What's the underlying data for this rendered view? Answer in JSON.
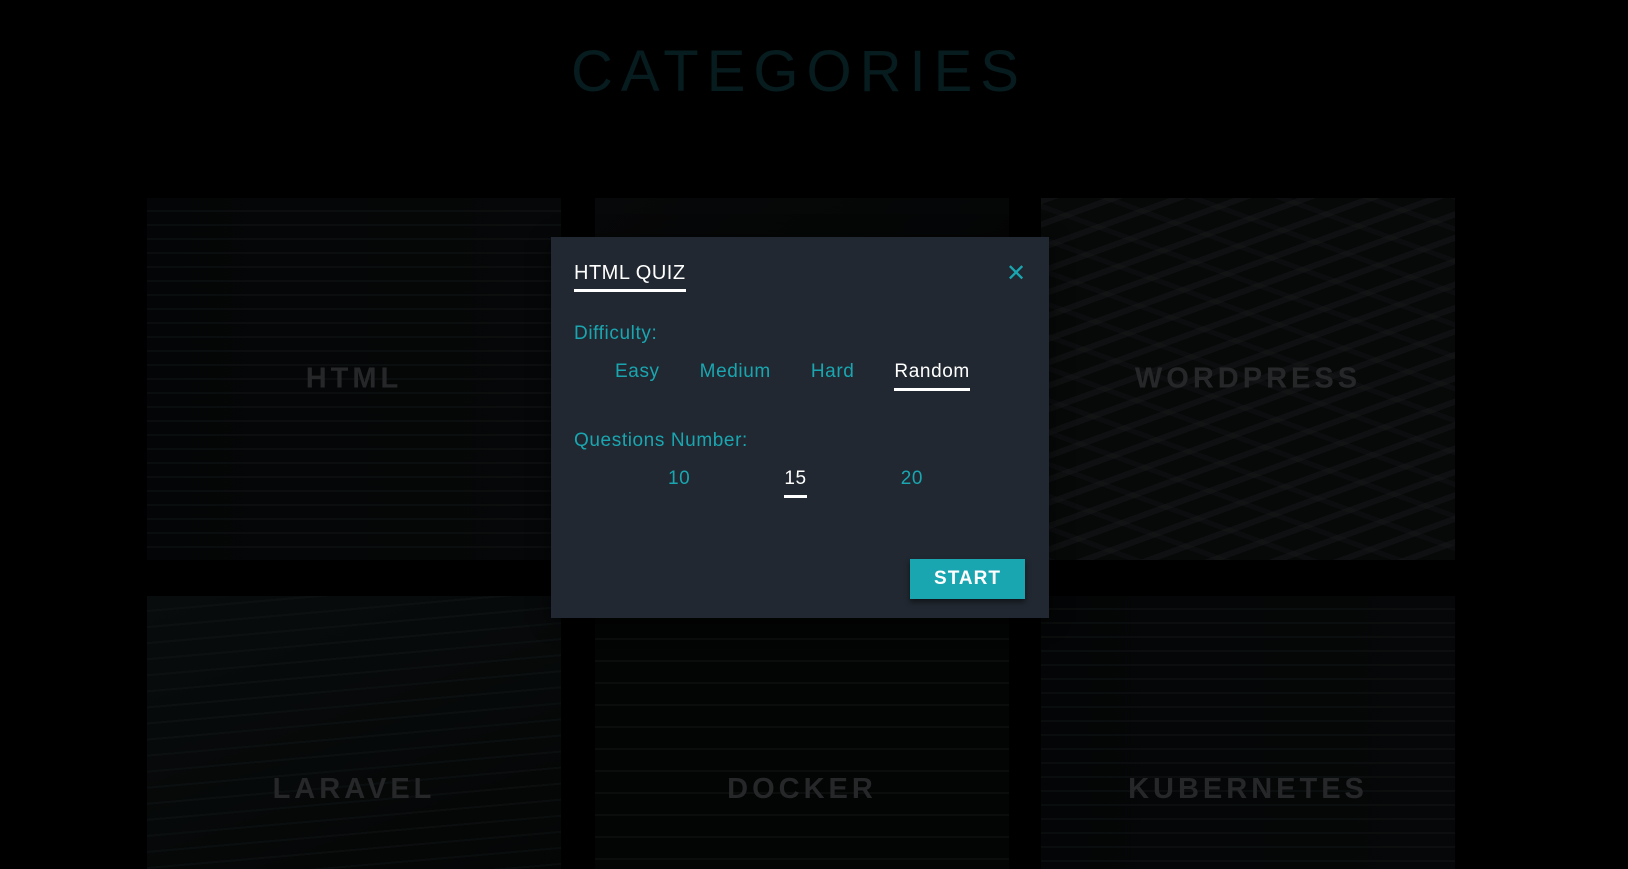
{
  "page": {
    "title": "CATEGORIES"
  },
  "categories": [
    {
      "label": "HTML",
      "texture": "code"
    },
    {
      "label": "",
      "texture": "dark"
    },
    {
      "label": "WORDPRESS",
      "texture": "cables"
    },
    {
      "label": "LARAVEL",
      "texture": "screen"
    },
    {
      "label": "DOCKER",
      "texture": "terminal"
    },
    {
      "label": "KUBERNETES",
      "texture": "code"
    }
  ],
  "modal": {
    "title": "HTML QUIZ",
    "close_icon": "close-icon",
    "difficulty": {
      "label": "Difficulty:",
      "options": [
        "Easy",
        "Medium",
        "Hard",
        "Random"
      ],
      "selected": "Random"
    },
    "questions": {
      "label": "Questions Number:",
      "options": [
        "10",
        "15",
        "20"
      ],
      "selected": "15"
    },
    "start_label": "START"
  },
  "colors": {
    "accent": "#1aa6b0",
    "modal_bg": "#212831",
    "selected": "#ffffff"
  }
}
